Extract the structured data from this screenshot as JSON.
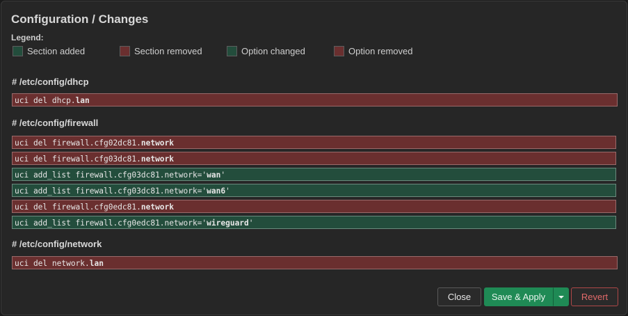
{
  "dialog": {
    "title": "Configuration / Changes",
    "legend_title": "Legend:",
    "legend": [
      {
        "label": "Section added",
        "color": "#234d3c"
      },
      {
        "label": "Section removed",
        "color": "#6a2f2f"
      },
      {
        "label": "Option changed",
        "color": "#234d3c"
      },
      {
        "label": "Option removed",
        "color": "#6a2f2f"
      }
    ]
  },
  "sections": [
    {
      "heading": "# /etc/config/dhcp",
      "lines": [
        {
          "type": "del",
          "prefix": "uci del dhcp.",
          "key": "lan",
          "suffix": ""
        }
      ]
    },
    {
      "heading": "# /etc/config/firewall",
      "lines": [
        {
          "type": "del",
          "prefix": "uci del firewall.cfg02dc81.",
          "key": "network",
          "suffix": ""
        },
        {
          "type": "del",
          "prefix": "uci del firewall.cfg03dc81.",
          "key": "network",
          "suffix": ""
        },
        {
          "type": "add",
          "prefix": "uci add_list firewall.cfg03dc81.network='",
          "key": "wan",
          "suffix": "'"
        },
        {
          "type": "add",
          "prefix": "uci add_list firewall.cfg03dc81.network='",
          "key": "wan6",
          "suffix": "'"
        },
        {
          "type": "del",
          "prefix": "uci del firewall.cfg0edc81.",
          "key": "network",
          "suffix": ""
        },
        {
          "type": "add",
          "prefix": "uci add_list firewall.cfg0edc81.network='",
          "key": "wireguard",
          "suffix": "'"
        }
      ]
    },
    {
      "heading": "# /etc/config/network",
      "lines": [
        {
          "type": "del",
          "prefix": "uci del network.",
          "key": "lan",
          "suffix": ""
        }
      ]
    }
  ],
  "buttons": {
    "close": "Close",
    "save_apply": "Save & Apply",
    "revert": "Revert"
  }
}
